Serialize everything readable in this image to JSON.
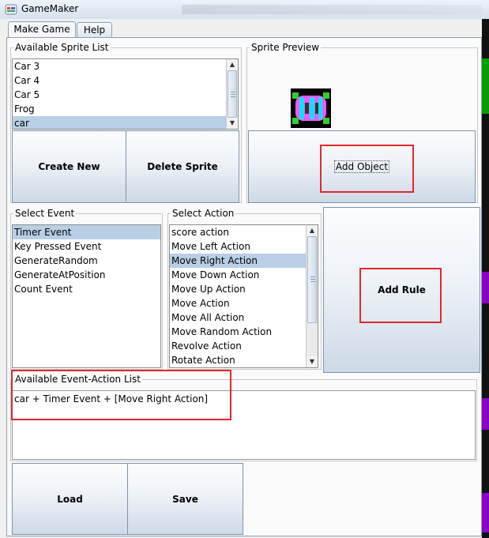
{
  "window": {
    "title": "GameMaker"
  },
  "tabs": [
    {
      "label": "Make Game",
      "selected": true
    },
    {
      "label": "Help",
      "selected": false
    }
  ],
  "sprite_list": {
    "legend": "Available Sprite List",
    "items": [
      "Car 3",
      "Car 4",
      "Car 5",
      "Frog",
      "car"
    ],
    "selected": "car"
  },
  "sprite_preview": {
    "legend": "Sprite Preview"
  },
  "buttons": {
    "create_new": "Create New",
    "delete_sprite": "Delete Sprite",
    "add_object": "Add Object",
    "add_rule": "Add Rule",
    "load": "Load",
    "save": "Save"
  },
  "event_list": {
    "legend": "Select Event",
    "items": [
      "Timer Event",
      "Key Pressed Event",
      "GenerateRandom",
      "GenerateAtPosition",
      "Count Event"
    ],
    "selected": "Timer Event"
  },
  "action_list": {
    "legend": "Select Action",
    "items": [
      "score action",
      "Move Left Action",
      "Move Right Action",
      "Move Down Action",
      "Move Up Action",
      "Move Action",
      "Move All Action",
      "Move Random Action",
      "Revolve Action",
      "Rotate Action"
    ],
    "selected": "Move Right Action"
  },
  "event_action_list": {
    "legend": "Available Event-Action List",
    "entries": [
      "car + Timer Event + [Move Right Action]"
    ]
  },
  "colors": {
    "highlight": "#e0282e",
    "selection": "#b8cfe5"
  }
}
